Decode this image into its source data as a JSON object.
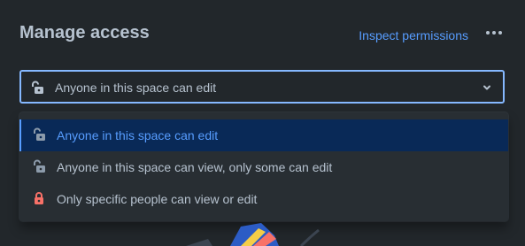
{
  "header": {
    "title": "Manage access",
    "inspect_link": "Inspect permissions",
    "more_icon": "more-horizontal-icon"
  },
  "select": {
    "value": "Anyone in this space can edit",
    "lock_icon": "unlocked-icon",
    "chevron_icon": "chevron-down-icon"
  },
  "options": [
    {
      "label": "Anyone in this space can edit",
      "icon": "unlocked-icon",
      "selected": true
    },
    {
      "label": "Anyone in this space can view, only some can edit",
      "icon": "unlocked-icon",
      "selected": false
    },
    {
      "label": "Only specific people can view or edit",
      "icon": "locked-icon",
      "selected": false
    }
  ],
  "colors": {
    "background": "#22272b",
    "accent": "#579dff",
    "selected_bg": "#092957",
    "text": "#b6c2cf",
    "lock_red": "#f87168"
  }
}
